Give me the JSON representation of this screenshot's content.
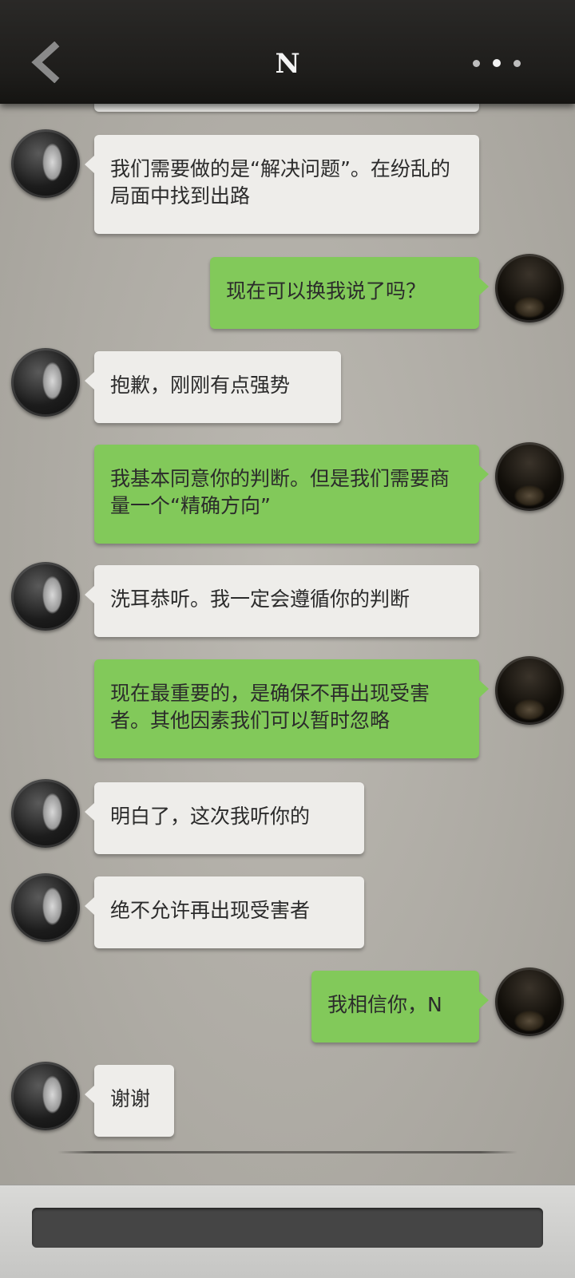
{
  "header": {
    "title": "N",
    "back_icon": "chevron-left-icon",
    "more_icon": "more-dots-icon"
  },
  "messages": [
    {
      "side": "in",
      "text": "我们需要做的是“解决问题”。在纷乱的局面中找到出路"
    },
    {
      "side": "out",
      "text": "现在可以换我说了吗？"
    },
    {
      "side": "in",
      "text": "抱歉，刚刚有点强势"
    },
    {
      "side": "out",
      "text": "我基本同意你的判断。但是我们需要商量一个“精确方向”"
    },
    {
      "side": "in",
      "text": "洗耳恭听。我一定会遵循你的判断"
    },
    {
      "side": "out",
      "text": "现在最重要的，是确保不再出现受害者。其他因素我们可以暂时忽略"
    },
    {
      "side": "in",
      "text": "明白了，这次我听你的"
    },
    {
      "side": "in",
      "text": "绝不允许再出现受害者"
    },
    {
      "side": "out",
      "text": "我相信你，N"
    },
    {
      "side": "in",
      "text": "谢谢"
    }
  ],
  "footer": {
    "input_value": ""
  },
  "colors": {
    "outgoing_bubble": "#82c95a",
    "incoming_bubble": "#eeedea",
    "header": "#1e1d1b"
  }
}
